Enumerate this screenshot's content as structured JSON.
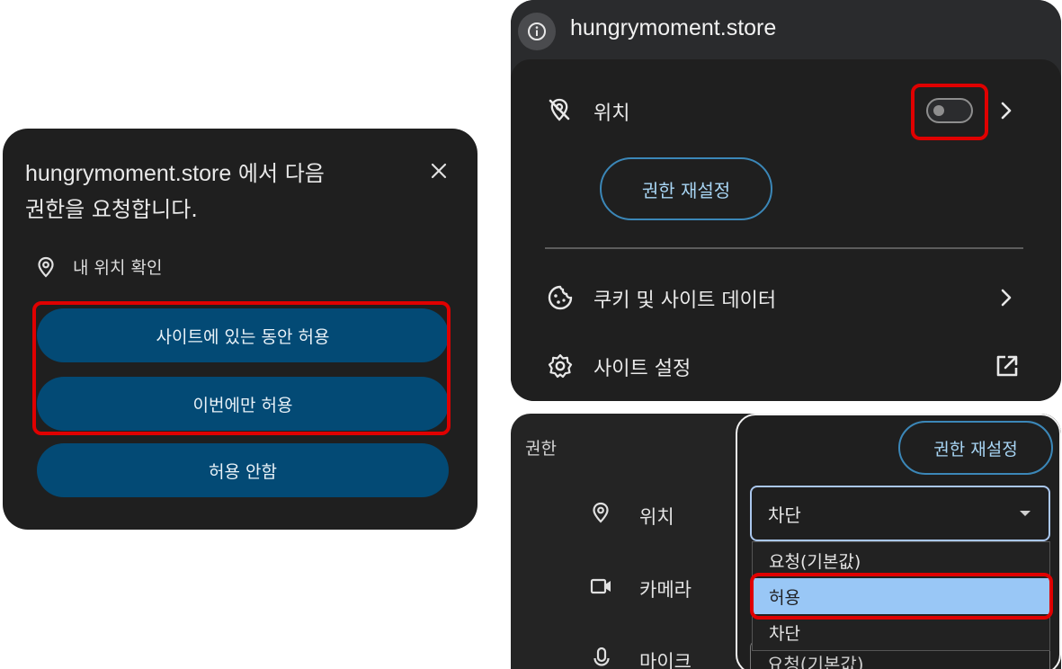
{
  "prompt": {
    "host": "hungrymoment.store",
    "title_suffix": "에서 다음",
    "title_line2": "권한을 요청합니다.",
    "permission": "내 위치 확인",
    "btn_allow_while_visiting": "사이트에 있는 동안 허용",
    "btn_allow_this_time": "이번에만 허용",
    "btn_deny": "허용 안함",
    "icons": {
      "close": "close-icon",
      "location": "location-pin-icon"
    }
  },
  "site_panel": {
    "host": "hungrymoment.store",
    "location_label": "위치",
    "location_toggle_on": false,
    "reset_permissions": "권한 재설정",
    "cookies_label": "쿠키 및 사이트 데이터",
    "site_settings_label": "사이트 설정",
    "icons": {
      "info": "info-icon",
      "location_off": "location-off-icon",
      "cookie": "cookie-icon",
      "gear": "gear-icon",
      "external": "open-external-icon",
      "chevron": "chevron-right-icon"
    }
  },
  "settings": {
    "section_title": "권한",
    "reset_permissions": "권한 재설정",
    "rows": [
      {
        "label": "위치",
        "icon": "location-pin-icon"
      },
      {
        "label": "카메라",
        "icon": "camera-icon"
      },
      {
        "label": "마이크",
        "icon": "microphone-icon"
      }
    ],
    "location_select_value": "차단",
    "dropdown_options": [
      "요청(기본값)",
      "허용",
      "차단"
    ],
    "dropdown_highlighted": "허용",
    "mic_select_value": "요청(기본값)"
  },
  "colors": {
    "panel_bg": "#1f1f1f",
    "prompt_button": "#034a75",
    "highlight_red": "#e00000",
    "option_selected": "#99c7f6",
    "outline_button": "#3b87b8"
  }
}
